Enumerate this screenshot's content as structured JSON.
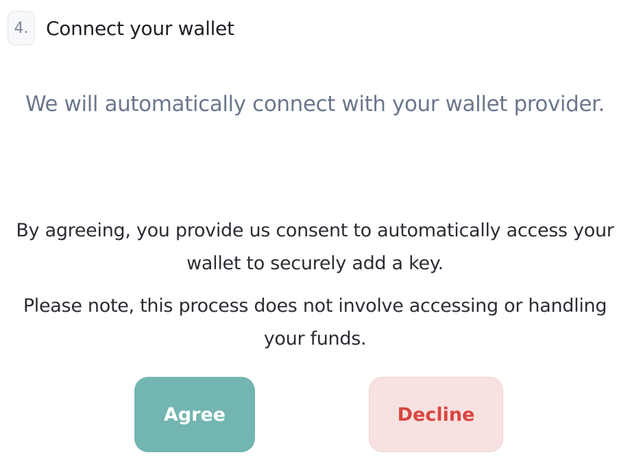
{
  "step": {
    "number": "4.",
    "title": "Connect your wallet"
  },
  "intro_text": "We will automatically connect with your wallet provider.",
  "consent": {
    "line1": "By agreeing, you provide us consent to automatically access your",
    "line2": "wallet to securely add a key."
  },
  "note": {
    "line1": "Please note, this process does not involve accessing or handling",
    "line2": "your funds."
  },
  "buttons": {
    "agree_label": "Agree",
    "decline_label": "Decline"
  },
  "colors": {
    "agree_bg": "#72b5b1",
    "decline_bg": "#f8e1e1",
    "decline_text": "#d9463f",
    "intro_text": "#6b778c"
  }
}
